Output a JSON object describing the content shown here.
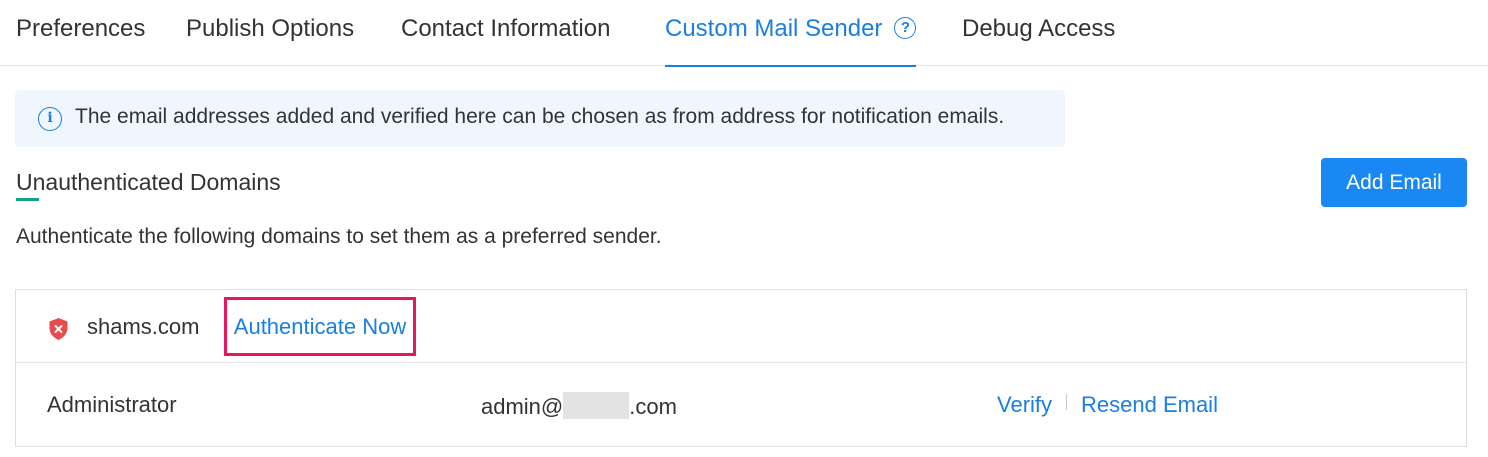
{
  "tabs": [
    {
      "label": "Preferences"
    },
    {
      "label": "Publish Options"
    },
    {
      "label": "Contact Information"
    },
    {
      "label": "Custom Mail Sender",
      "help_icon": "?"
    },
    {
      "label": "Debug Access"
    }
  ],
  "info_banner": {
    "icon": "info-icon",
    "text": "The email addresses added and verified here can be chosen as from address for notification emails."
  },
  "section": {
    "title": "Unauthenticated Domains",
    "description": "Authenticate the following domains to set them as a preferred sender.",
    "add_button": "Add Email"
  },
  "domains": [
    {
      "domain": "shams.com",
      "status_icon": "shield-error-icon",
      "authenticate_label": "Authenticate Now",
      "rows": [
        {
          "role": "Administrator",
          "email_prefix": "admin@",
          "email_suffix": ".com",
          "verify_label": "Verify",
          "resend_label": "Resend Email"
        }
      ]
    }
  ],
  "colors": {
    "accent": "#1a7fe0",
    "button": "#1a88f2",
    "highlight_border": "#e8175d",
    "error_icon": "#e74c4c",
    "title_underline": "#16a085",
    "banner_bg": "#eff6fd"
  }
}
